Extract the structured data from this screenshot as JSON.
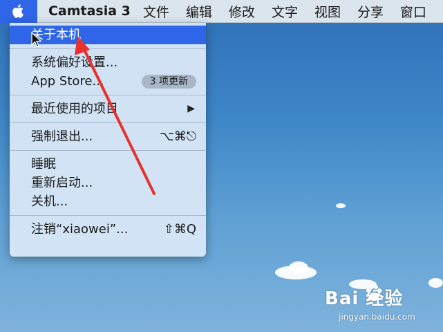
{
  "menubar": {
    "apple_icon": "apple-logo",
    "app_name": "Camtasia 3",
    "menus": [
      "文件",
      "编辑",
      "修改",
      "文字",
      "视图",
      "分享",
      "窗口"
    ]
  },
  "apple_menu": {
    "about": "关于本机",
    "system_prefs": "系统偏好设置...",
    "app_store": "App Store...",
    "app_store_badge": "3 项更新",
    "recent_items": "最近使用的项目",
    "recent_arrow": "▶",
    "force_quit": "强制退出...",
    "force_quit_shortcut": "⌥⌘⎋",
    "sleep": "睡眠",
    "restart": "重新启动...",
    "shutdown": "关机...",
    "logout": "注销“xiaowei”...",
    "logout_shortcut": "⇧⌘Q"
  },
  "watermark": {
    "main": "Bai  经验",
    "sub": "jingyan.baidu.com"
  },
  "colors": {
    "selection": "#2f66e7",
    "annotation_arrow": "#e8302e",
    "menubar": "#dbe5ee"
  }
}
